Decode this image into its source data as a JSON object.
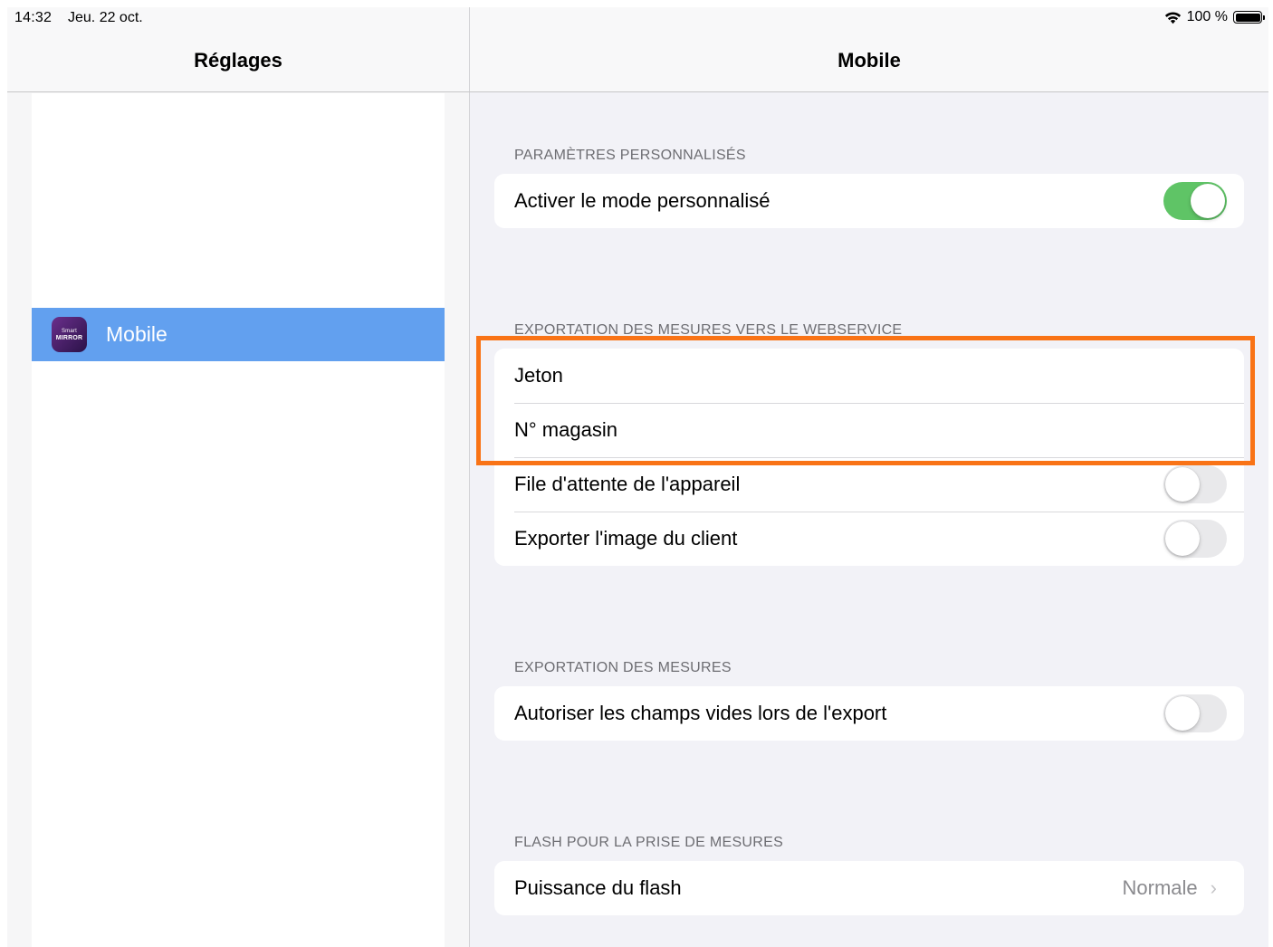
{
  "status_bar": {
    "time": "14:32",
    "date": "Jeu. 22 oct.",
    "battery": "100 %"
  },
  "sidebar": {
    "title": "Réglages",
    "items": [
      {
        "label": "Mobile",
        "icon": "smart-mirror-app-icon",
        "icon_text_top": "Smart",
        "icon_text_bottom": "MIRROR",
        "selected": true
      }
    ]
  },
  "detail": {
    "title": "Mobile",
    "sections": [
      {
        "header": "PARAMÈTRES PERSONNALISÉS",
        "rows": [
          {
            "label": "Activer le mode personnalisé",
            "type": "toggle",
            "on": true
          }
        ]
      },
      {
        "header": "EXPORTATION DES MESURES VERS LE WEBSERVICE",
        "rows": [
          {
            "label": "Jeton",
            "type": "text"
          },
          {
            "label": "N° magasin",
            "type": "text"
          },
          {
            "label": "File d'attente de l'appareil",
            "type": "toggle",
            "on": false
          },
          {
            "label": "Exporter l'image du client",
            "type": "toggle",
            "on": false
          }
        ]
      },
      {
        "header": "EXPORTATION DES MESURES",
        "rows": [
          {
            "label": "Autoriser les champs vides lors de l'export",
            "type": "toggle",
            "on": false
          }
        ]
      },
      {
        "header": "FLASH POUR LA PRISE DE MESURES",
        "rows": [
          {
            "label": "Puissance du flash",
            "type": "disclosure",
            "value": "Normale"
          }
        ]
      }
    ]
  },
  "colors": {
    "selection": "#62a0ef",
    "toggle_on": "#5fc466",
    "highlight": "#f97316"
  }
}
